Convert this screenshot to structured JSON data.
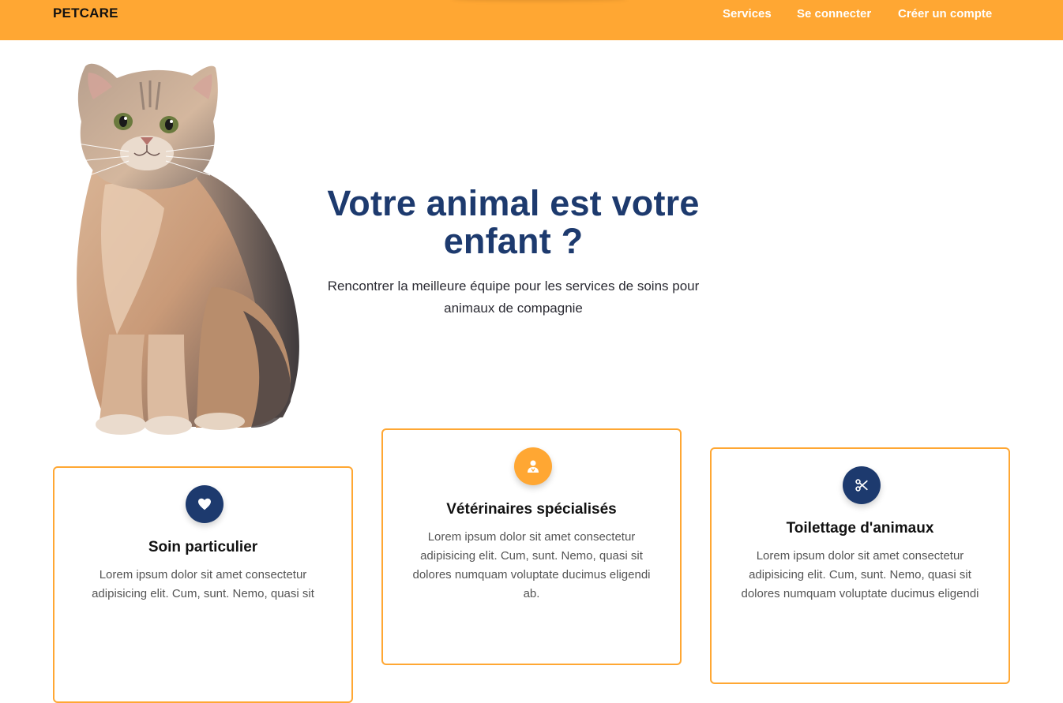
{
  "nav": {
    "brand": "PETCARE",
    "links": {
      "services": "Services",
      "login": "Se connecter",
      "register": "Créer un compte"
    }
  },
  "hero": {
    "title_line1": "Votre animal est votre",
    "title_line2": "enfant ?",
    "subtitle_line1": "Rencontrer la meilleure équipe pour les services de soins pour",
    "subtitle_line2": "animaux de compagnie",
    "image_icon": "cat-photo"
  },
  "cards": [
    {
      "icon": "heart-icon",
      "title": "Soin particulier",
      "text": "Lorem ipsum dolor sit amet consectetur adipisicing elit. Cum, sunt. Nemo, quasi sit"
    },
    {
      "icon": "vet-icon",
      "title": "Vétérinaires spécialisés",
      "text": "Lorem ipsum dolor sit amet consectetur adipisicing elit. Cum, sunt. Nemo, quasi sit dolores numquam voluptate ducimus eligendi ab."
    },
    {
      "icon": "scissors-icon",
      "title": "Toilettage d'animaux",
      "text": "Lorem ipsum dolor sit amet consectetur adipisicing elit. Cum, sunt. Nemo, quasi sit dolores numquam voluptate ducimus eligendi"
    }
  ],
  "colors": {
    "accent": "#ffa733",
    "navy": "#1d3a6e"
  }
}
